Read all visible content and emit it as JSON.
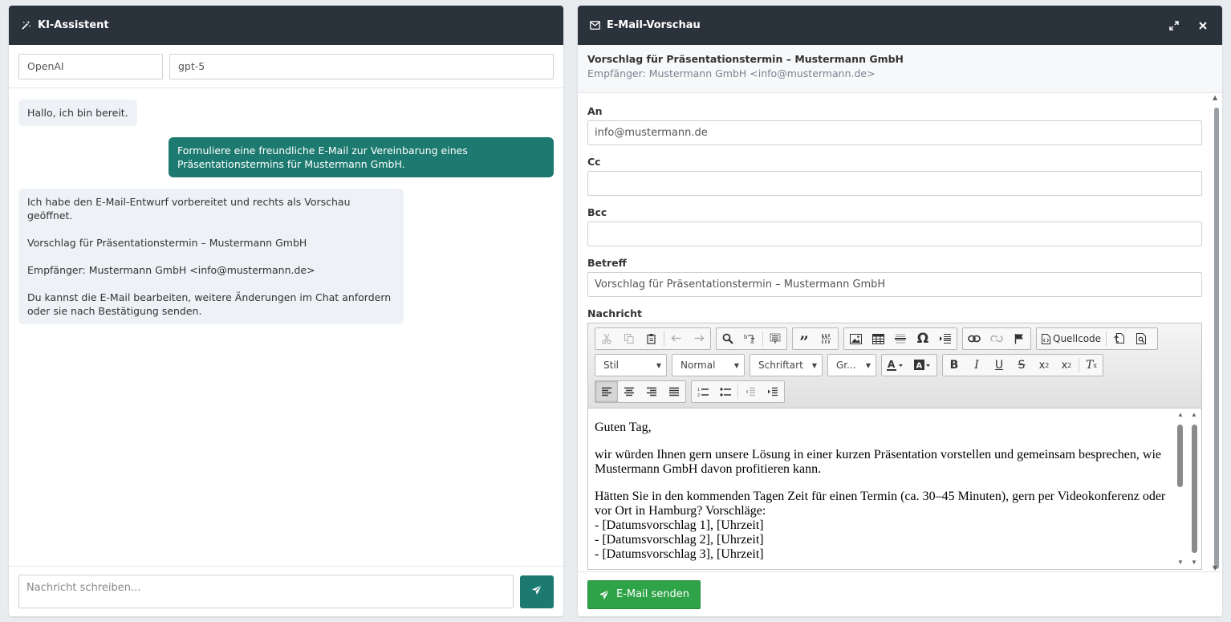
{
  "assistant": {
    "title": "KI-Assistent",
    "provider": "OpenAI",
    "model": "gpt-5",
    "messages": [
      {
        "role": "bot",
        "paragraphs": [
          "Hallo, ich bin bereit."
        ]
      },
      {
        "role": "user",
        "paragraphs": [
          "Formuliere eine freundliche E-Mail zur Vereinbarung eines Präsentationstermins für Mustermann GmbH."
        ]
      },
      {
        "role": "bot",
        "paragraphs": [
          "Ich habe den E-Mail-Entwurf vorbereitet und rechts als Vorschau geöffnet.",
          "Vorschlag für Präsentationstermin – Mustermann GmbH",
          "Empfänger: Mustermann GmbH <info@mustermann.de>",
          "Du kannst die E-Mail bearbeiten, weitere Änderungen im Chat anfordern oder sie nach Bestätigung senden."
        ]
      }
    ],
    "composer_placeholder": "Nachricht schreiben..."
  },
  "preview": {
    "title": "E-Mail-Vorschau",
    "subject_heading": "Vorschlag für Präsentationstermin – Mustermann GmbH",
    "recipient_line": "Empfänger: Mustermann GmbH <info@mustermann.de>",
    "labels": {
      "to": "An",
      "cc": "Cc",
      "bcc": "Bcc",
      "subject": "Betreff",
      "message": "Nachricht"
    },
    "fields": {
      "to": "info@mustermann.de",
      "cc": "",
      "bcc": "",
      "subject": "Vorschlag für Präsentationstermin – Mustermann GmbH"
    },
    "toolbar": {
      "source_label": "Quellcode",
      "style_combo": "Stil",
      "format_combo": "Normal",
      "font_combo": "Schriftart",
      "size_combo": "Gr..."
    },
    "body": [
      "Guten Tag,",
      "wir würden Ihnen gern unsere Lösung in einer kurzen Präsentation vorstellen und gemeinsam besprechen, wie Mustermann GmbH davon profitieren kann.",
      "Hätten Sie in den kommenden Tagen Zeit für einen Termin (ca. 30–45 Minuten), gern per Videokonferenz oder vor Ort in Hamburg? Vorschläge:\n- [Datumsvorschlag 1], [Uhrzeit]\n- [Datumsvorschlag 2], [Uhrzeit]\n- [Datumsvorschlag 3], [Uhrzeit]"
    ],
    "send_label": "E-Mail senden"
  }
}
